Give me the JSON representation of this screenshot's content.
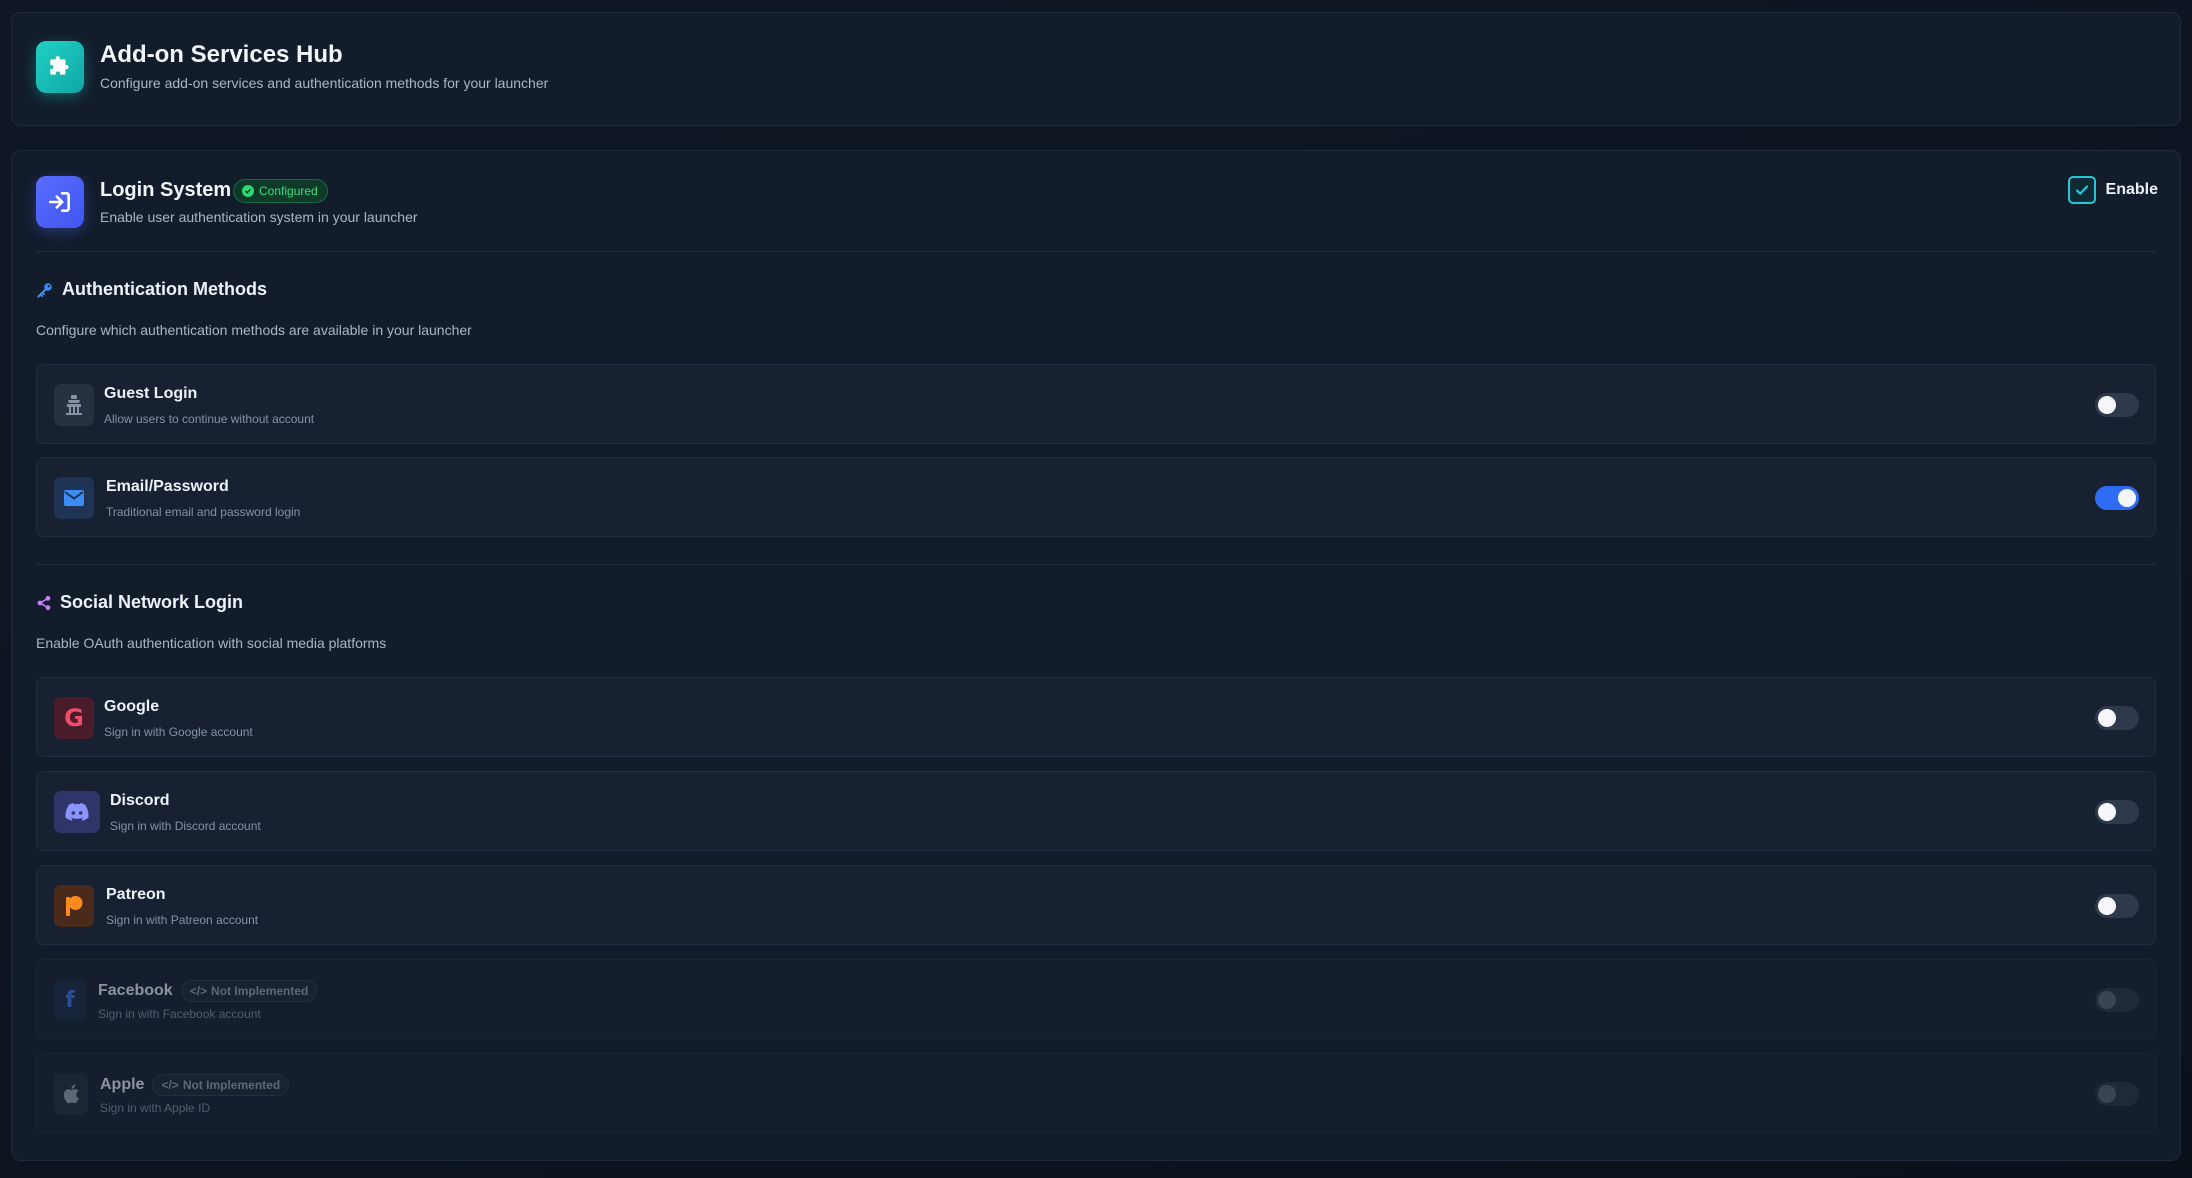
{
  "header": {
    "title": "Add-on Services Hub",
    "subtitle": "Configure add-on services and authentication methods for your launcher",
    "icon": "puzzle-icon"
  },
  "login_system": {
    "title": "Login System",
    "badge": "Configured",
    "subtitle": "Enable user authentication system in your launcher",
    "enable_label": "Enable",
    "enabled": true,
    "icon": "login-icon"
  },
  "auth_methods": {
    "title": "Authentication Methods",
    "subtitle": "Configure which authentication methods are available in your launcher",
    "icon": "key-icon",
    "items": [
      {
        "name": "Guest Login",
        "desc": "Allow users to continue without account",
        "icon": "guest-icon",
        "enabled": false
      },
      {
        "name": "Email/Password",
        "desc": "Traditional email and password login",
        "icon": "envelope-icon",
        "enabled": true
      }
    ]
  },
  "social_login": {
    "title": "Social Network Login",
    "subtitle": "Enable OAuth authentication with social media platforms",
    "icon": "share-icon",
    "not_implemented_label": "Not Implemented",
    "items": [
      {
        "name": "Google",
        "desc": "Sign in with Google account",
        "icon": "google-icon",
        "enabled": false,
        "implemented": true
      },
      {
        "name": "Discord",
        "desc": "Sign in with Discord account",
        "icon": "discord-icon",
        "enabled": false,
        "implemented": true
      },
      {
        "name": "Patreon",
        "desc": "Sign in with Patreon account",
        "icon": "patreon-icon",
        "enabled": false,
        "implemented": true
      },
      {
        "name": "Facebook",
        "desc": "Sign in with Facebook account",
        "icon": "facebook-icon",
        "enabled": false,
        "implemented": false
      },
      {
        "name": "Apple",
        "desc": "Sign in with Apple ID",
        "icon": "apple-icon",
        "enabled": false,
        "implemented": false
      }
    ]
  },
  "colors": {
    "accent_teal": "#21d1c4",
    "accent_blue": "#2f6cf5",
    "configured_green": "#34e07e"
  }
}
